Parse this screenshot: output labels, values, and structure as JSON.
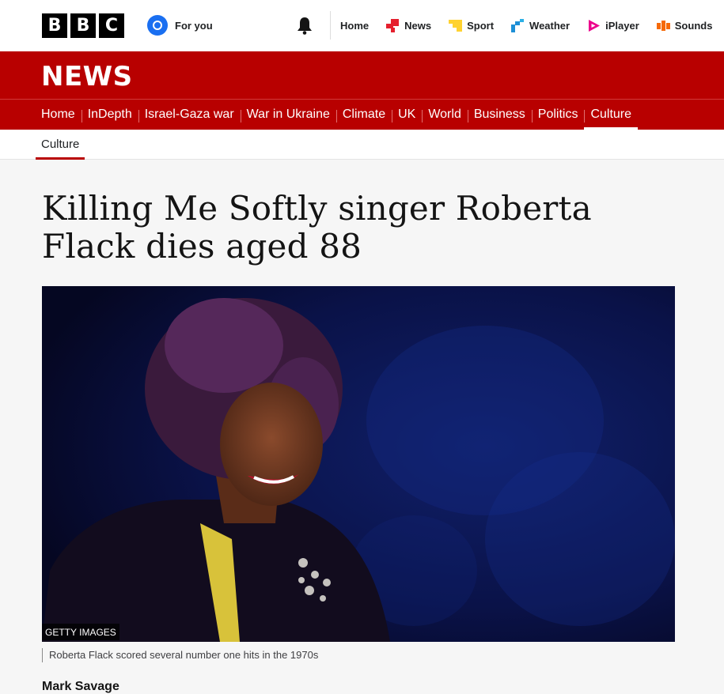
{
  "header": {
    "logo_letters": [
      "B",
      "B",
      "C"
    ],
    "for_you": "For you",
    "nav": [
      {
        "label": "Home",
        "icon": "none"
      },
      {
        "label": "News",
        "icon": "news-icon",
        "color": "#e5202e"
      },
      {
        "label": "Sport",
        "icon": "sport-icon",
        "color": "#ffd230"
      },
      {
        "label": "Weather",
        "icon": "weather-icon",
        "color": "#1d8fd6"
      },
      {
        "label": "iPlayer",
        "icon": "iplayer-icon",
        "color": "#ec008c"
      },
      {
        "label": "Sounds",
        "icon": "sounds-icon",
        "color": "#f66a0a"
      }
    ]
  },
  "news_band": {
    "brand": "NEWS",
    "color": "#b80000",
    "sections": [
      "Home",
      "InDepth",
      "Israel-Gaza war",
      "War in Ukraine",
      "Climate",
      "UK",
      "World",
      "Business",
      "Politics",
      "Culture"
    ],
    "active_section": "Culture"
  },
  "secondary_nav": {
    "label": "Culture"
  },
  "article": {
    "headline": "Killing Me Softly singer Roberta Flack dies aged 88",
    "image_credit": "GETTY IMAGES",
    "caption": "Roberta Flack scored several number one hits in the 1970s",
    "author": "Mark Savage"
  }
}
